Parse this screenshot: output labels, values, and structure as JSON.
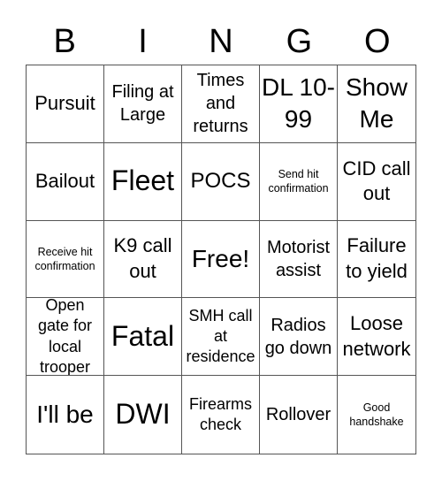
{
  "header": [
    "B",
    "I",
    "N",
    "G",
    "O"
  ],
  "cells": [
    [
      "Pursuit",
      "Filing at Large",
      "Times and returns",
      "DL 10-99",
      "Show Me"
    ],
    [
      "Bailout",
      "Fleet",
      "POCS",
      "Send hit confirmation",
      "CID call out"
    ],
    [
      "Receive hit confirmation",
      "K9 call out",
      "Free!",
      "Motorist assist",
      "Failure to yield"
    ],
    [
      "Open gate for local trooper",
      "Fatal",
      "SMH call at residence",
      "Radios go down",
      "Loose network"
    ],
    [
      "I'll be",
      "DWI",
      "Firearms check",
      "Rollover",
      "Good handshake"
    ]
  ]
}
